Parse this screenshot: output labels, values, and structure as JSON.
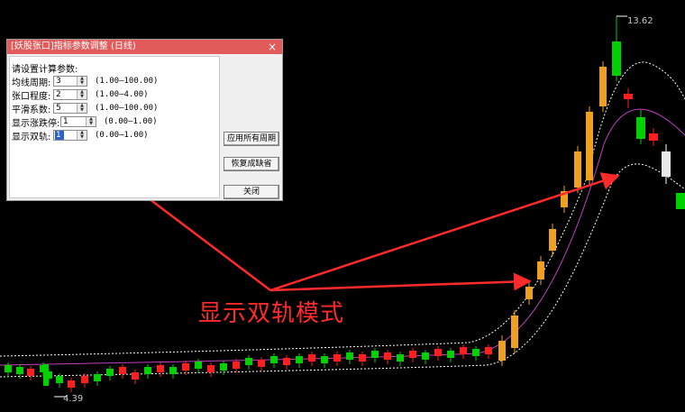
{
  "dialog": {
    "title": "[妖股张口]指标参数调整 (日线)",
    "prompt": "请设置计算参数:",
    "params": [
      {
        "label": "均线周期:",
        "value": "3",
        "range": "(1.00—100.00)"
      },
      {
        "label": "张口程度:",
        "value": "2",
        "range": "(1.00—4.00)"
      },
      {
        "label": "平滑系数:",
        "value": "5",
        "range": "(1.00—100.00)"
      },
      {
        "label": "显示涨跌停:",
        "value": "1",
        "range": "(0.00—1.00)"
      },
      {
        "label": "显示双轨:",
        "value": "1",
        "range": "(0.00—1.00)"
      }
    ],
    "buttons": {
      "apply_all": "应用所有周期",
      "restore": "恢复成缺省",
      "close": "关闭"
    },
    "close_glyph": "×"
  },
  "chart": {
    "high_label": "13.62",
    "low_label": "4.39"
  },
  "annotation": {
    "text": "显示双轨模式",
    "color": "#ff2a2a"
  },
  "colors": {
    "up": "#ff1f1f",
    "down": "#00d000",
    "limit_up": "#f0a020",
    "mid_line": "#c040c0",
    "band": "#ffffff"
  }
}
